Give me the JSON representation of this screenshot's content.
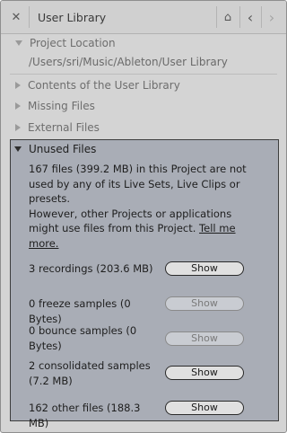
{
  "header": {
    "close_glyph": "✕",
    "title": "User Library",
    "home_glyph": "⌂",
    "back_glyph": "‹",
    "forward_glyph": "›"
  },
  "sections": {
    "project_location": "Project Location",
    "path": "/Users/sri/Music/Ableton/User Library",
    "contents": "Contents of the User Library",
    "missing": "Missing Files",
    "external": "External Files"
  },
  "unused": {
    "title": "Unused Files",
    "desc_1": "167 files (399.2 MB) in this Project are not used by any of its Live Sets, Live Clips or presets.",
    "desc_2": "However, other Projects or applications might use files from this Project.",
    "link": "Tell me more.",
    "rows": [
      {
        "label": "3 recordings (203.6 MB)",
        "button": "Show"
      },
      {
        "label": "0 freeze samples (0 Bytes)",
        "button": "Show"
      },
      {
        "label": "0 bounce samples (0 Bytes)",
        "button": "Show"
      },
      {
        "label": "2 consolidated samples (7.2 MB)",
        "button": "Show"
      },
      {
        "label": "162 other files (188.3 MB)",
        "button": "Show"
      }
    ]
  }
}
